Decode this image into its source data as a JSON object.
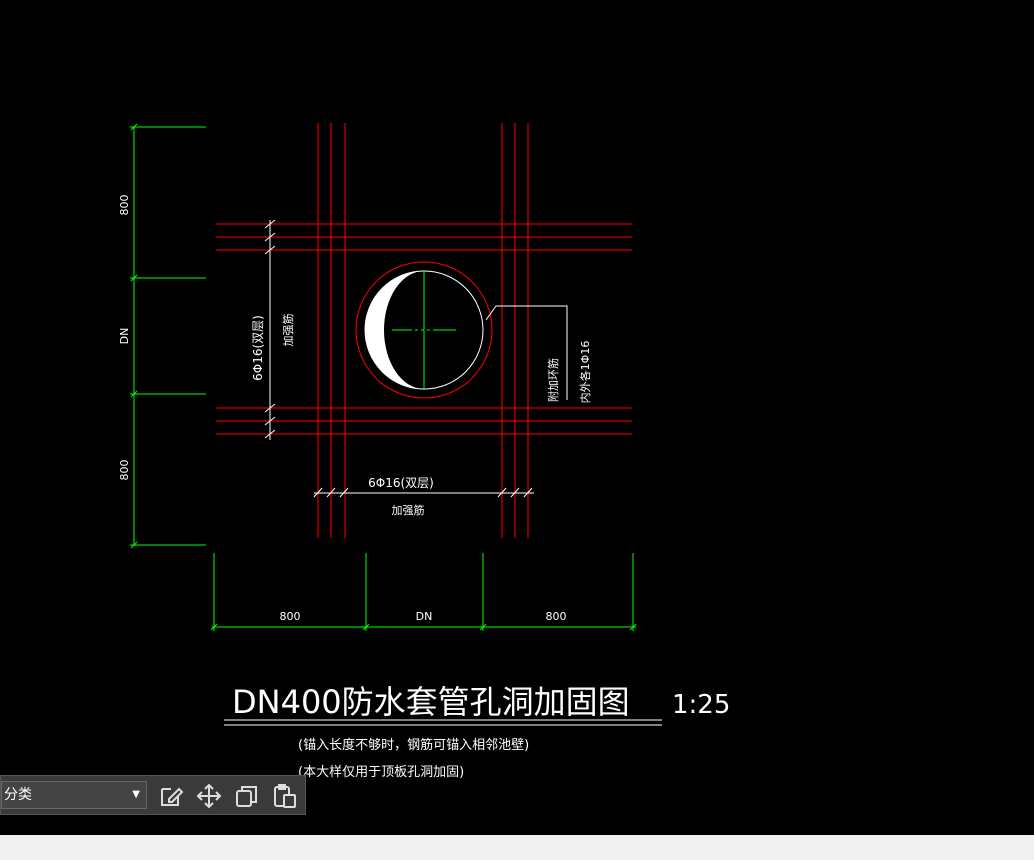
{
  "drawing": {
    "dim_left_top": "800",
    "dim_left_mid": "DN",
    "dim_left_bot": "800",
    "dim_bot_left": "800",
    "dim_bot_mid": "DN",
    "dim_bot_right": "800",
    "rebar_vertical_label": "6Φ16(双层)",
    "rebar_vertical_note": "加强筋",
    "rebar_horizontal_label": "6Φ16(双层)",
    "rebar_horizontal_note": "加强筋",
    "ring_label_1": "附加环筋",
    "ring_label_2": "内外各1Φ16",
    "title": "DN400防水套管孔洞加固图",
    "scale": "1:25",
    "note_1": "(锚入长度不够时，钢筋可锚入相邻池壁)",
    "note_2": "(本大样仅用于顶板孔洞加固)"
  },
  "toolbar": {
    "category_value": "分类",
    "dropdown_arrow": "▼",
    "icons": [
      "edit-icon",
      "move-icon",
      "copy-icon",
      "paste-icon"
    ]
  },
  "colors": {
    "background": "#000000",
    "rebar": "#ff0000",
    "dimension": "#00ff00",
    "text": "#ffffff"
  }
}
